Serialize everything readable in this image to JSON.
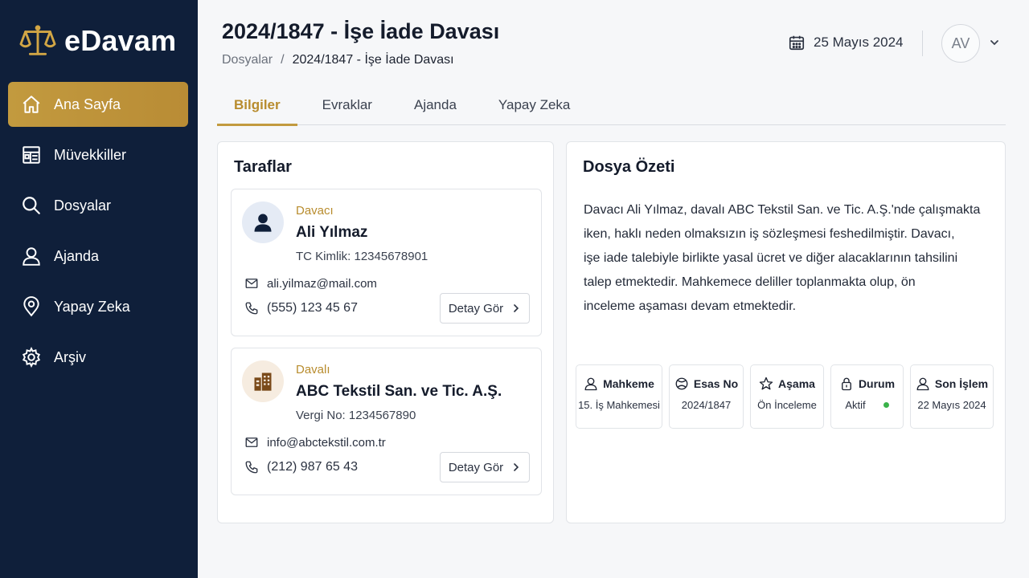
{
  "app": {
    "name": "eDavam",
    "accent_color": "#c29a3f",
    "sidebar_color": "#0f1f3a"
  },
  "sidebar": {
    "items": [
      {
        "label": "Ana Sayfa",
        "icon": "home-icon",
        "active": true
      },
      {
        "label": "Müvekkiller",
        "icon": "clients-icon",
        "active": false
      },
      {
        "label": "Dosyalar",
        "icon": "search-icon",
        "active": false
      },
      {
        "label": "Ajanda",
        "icon": "user-icon",
        "active": false
      },
      {
        "label": "Yapay Zeka",
        "icon": "location-pin-icon",
        "active": false
      },
      {
        "label": "Arşiv",
        "icon": "gear-icon",
        "active": false
      }
    ]
  },
  "header": {
    "title": "2024/1847 - İşe İade Davası",
    "breadcrumb": {
      "parent": "Dosyalar",
      "separator": "/",
      "current": "2024/1847 - İşe İade Davası"
    },
    "date": "25 Mayıs 2024",
    "avatar_initials": "AV"
  },
  "tabs": [
    {
      "label": "Bilgiler",
      "active": true
    },
    {
      "label": "Evraklar",
      "active": false
    },
    {
      "label": "Ajanda",
      "active": false
    },
    {
      "label": "Yapay Zeka",
      "active": false
    }
  ],
  "parties": {
    "title": "Taraflar",
    "items": [
      {
        "role": "Davacı",
        "name": "Ali Yılmaz",
        "id_line": "TC Kimlik: 12345678901",
        "email": "ali.yilmaz@mail.com",
        "phone": "(555) 123 45 67",
        "button": "Detay Gör",
        "icon": "person-icon"
      },
      {
        "role": "Davalı",
        "name": "ABC Tekstil San. ve Tic. A.Ş.",
        "id_line": "Vergi No: 1234567890",
        "email": "info@abctekstil.com.tr",
        "phone": "(212) 987 65 43",
        "button": "Detay Gör",
        "icon": "building-icon"
      }
    ]
  },
  "summary": {
    "title": "Dosya Özeti",
    "lines": [
      "Davacı Ali Yılmaz, davalı ABC Tekstil San. ve Tic. A.Ş.'nde çalışmakta",
      "iken, haklı neden olmaksızın iş sözleşmesi feshedilmiştir. Davacı,",
      "işe iade talebiyle birlikte yasal ücret ve diğer alacaklarının tahsilini",
      "talep etmektedir. Mahkemece deliller toplanmakta olup, ön",
      "inceleme aşaması devam etmektedir."
    ],
    "info": [
      {
        "label": "Mahkeme",
        "value": "15. İş Mahkemesi",
        "icon": "user-icon"
      },
      {
        "label": "Esas No",
        "value": "2024/1847",
        "icon": "ball-icon"
      },
      {
        "label": "Aşama",
        "value": "Ön İnceleme",
        "icon": "star-icon"
      },
      {
        "label": "Durum",
        "value": "Aktif",
        "icon": "lock-icon",
        "status_color": "#3ab24a"
      },
      {
        "label": "Son İşlem",
        "value": "22 Mayıs 2024",
        "icon": "user-icon"
      }
    ]
  }
}
